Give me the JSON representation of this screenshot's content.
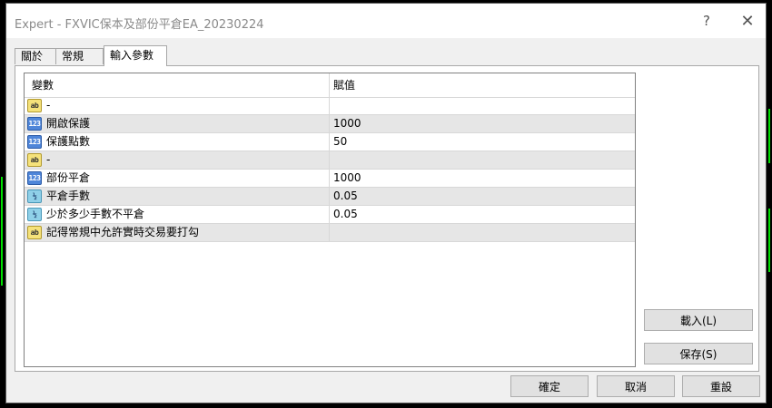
{
  "window": {
    "title": "Expert - FXVIC保本及部份平倉EA_20230224",
    "help_glyph": "?",
    "close_glyph": "✕"
  },
  "tabs": [
    {
      "label": "關於"
    },
    {
      "label": "常規"
    },
    {
      "label": "輸入參數"
    }
  ],
  "grid": {
    "columns": {
      "variable": "變數",
      "value": "賦值"
    },
    "rows": [
      {
        "icon": "string-type-icon",
        "icon_text": "ab",
        "name": "-",
        "value": ""
      },
      {
        "icon": "integer-type-icon",
        "icon_text": "123",
        "name": "開啟保護",
        "value": "1000"
      },
      {
        "icon": "integer-type-icon",
        "icon_text": "123",
        "name": "保護點數",
        "value": "50"
      },
      {
        "icon": "string-type-icon",
        "icon_text": "ab",
        "name": "-",
        "value": ""
      },
      {
        "icon": "integer-type-icon",
        "icon_text": "123",
        "name": "部份平倉",
        "value": "1000"
      },
      {
        "icon": "double-type-icon",
        "icon_text": "½",
        "name": "平倉手數",
        "value": "0.05"
      },
      {
        "icon": "double-type-icon",
        "icon_text": "½",
        "name": "少於多少手數不平倉",
        "value": "0.05"
      },
      {
        "icon": "string-type-icon",
        "icon_text": "ab",
        "name": "記得常規中允許實時交易要打勾",
        "value": ""
      }
    ]
  },
  "buttons": {
    "load": "載入(L)",
    "save": "保存(S)",
    "ok": "確定",
    "cancel": "取消",
    "reset": "重設"
  },
  "colors": {
    "candle_green": "#00e000",
    "dialog_bg": "#f0f0f0",
    "row_alt": "#e6e6e6"
  }
}
